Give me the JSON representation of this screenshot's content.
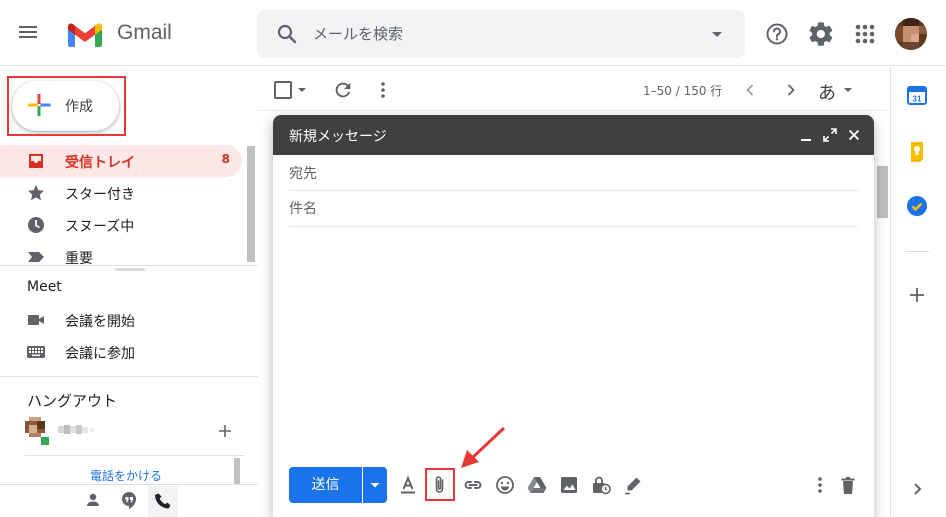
{
  "header": {
    "app_title": "Gmail",
    "search_placeholder": "メールを検索"
  },
  "sidebar": {
    "compose_label": "作成",
    "items": [
      {
        "label": "受信トレイ",
        "count": "8",
        "icon": "inbox-icon",
        "active": true
      },
      {
        "label": "スター付き",
        "icon": "star-icon"
      },
      {
        "label": "スヌーズ中",
        "icon": "clock-icon"
      },
      {
        "label": "重要",
        "icon": "important-icon"
      }
    ],
    "meet": {
      "heading": "Meet",
      "items": [
        {
          "label": "会議を開始",
          "icon": "video-camera-icon"
        },
        {
          "label": "会議に参加",
          "icon": "keyboard-icon"
        }
      ]
    },
    "hangouts": {
      "heading": "ハングアウト",
      "call_link": "電話をかける"
    }
  },
  "toolbar": {
    "page_count": "1–50 / 150 行",
    "input_tools": "あ"
  },
  "compose": {
    "title": "新規メッセージ",
    "to_placeholder": "宛先",
    "subject_placeholder": "件名",
    "send_label": "送信",
    "toolbar_icons": [
      "format-text-icon",
      "attach-file-icon",
      "insert-link-icon",
      "emoji-icon",
      "google-drive-icon",
      "insert-photo-icon",
      "confidential-mode-icon",
      "signature-icon"
    ]
  },
  "right_rail": {
    "calendar_day": "31",
    "icons": [
      "calendar-icon",
      "keep-icon",
      "tasks-icon",
      "add-addon-icon",
      "expand-panel-icon"
    ]
  },
  "colors": {
    "accent_red": "#d93025",
    "send_blue": "#1a73e8",
    "compose_header": "#404040",
    "highlight_red": "#e53935"
  }
}
